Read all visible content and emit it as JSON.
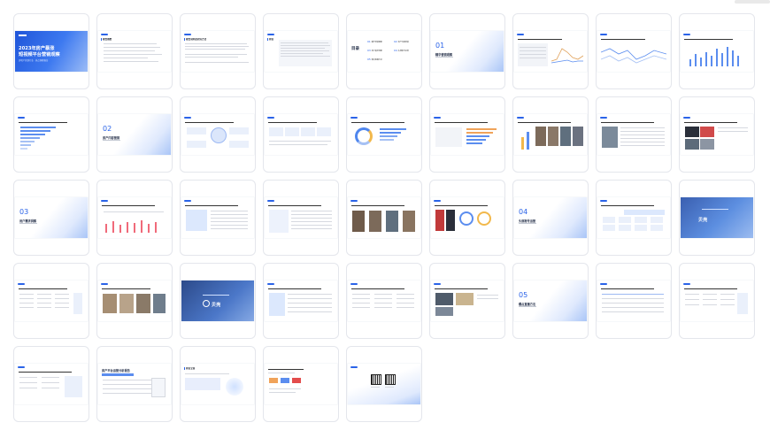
{
  "cover": {
    "title_line1": "2023年房产暴涨",
    "title_line2": "短视频平台营销观察",
    "subtitle": "房地产营销行业 · 热点洞察报告"
  },
  "slide_titles": {
    "s1": "报告摘要",
    "s2": "报告说明及研究方法",
    "s3": "前言",
    "s4_toc_label": "目录",
    "s21_title": "前言立意",
    "s25_title": "客户服务"
  },
  "sections": [
    {
      "num": "01",
      "title": "精华营销观察"
    },
    {
      "num": "02",
      "title": "房产内容营销"
    },
    {
      "num": "03",
      "title": "用户需求洞察"
    },
    {
      "num": "04",
      "title": "头部账号运营"
    },
    {
      "num": "05",
      "title": "爆点直播方法"
    }
  ],
  "toc": [
    {
      "num": "01",
      "label": "精华营销观察"
    },
    {
      "num": "02",
      "label": "房产内容营销"
    },
    {
      "num": "03",
      "label": "用户需求洞察"
    },
    {
      "num": "04",
      "label": "头部账号运营"
    },
    {
      "num": "05",
      "label": "爆点直播方法"
    }
  ],
  "dark_slide_text": {
    "s31_brand": "贝壳",
    "s32_brand": "贝壳"
  },
  "report_subtitle": "房产平台运营分析报告"
}
